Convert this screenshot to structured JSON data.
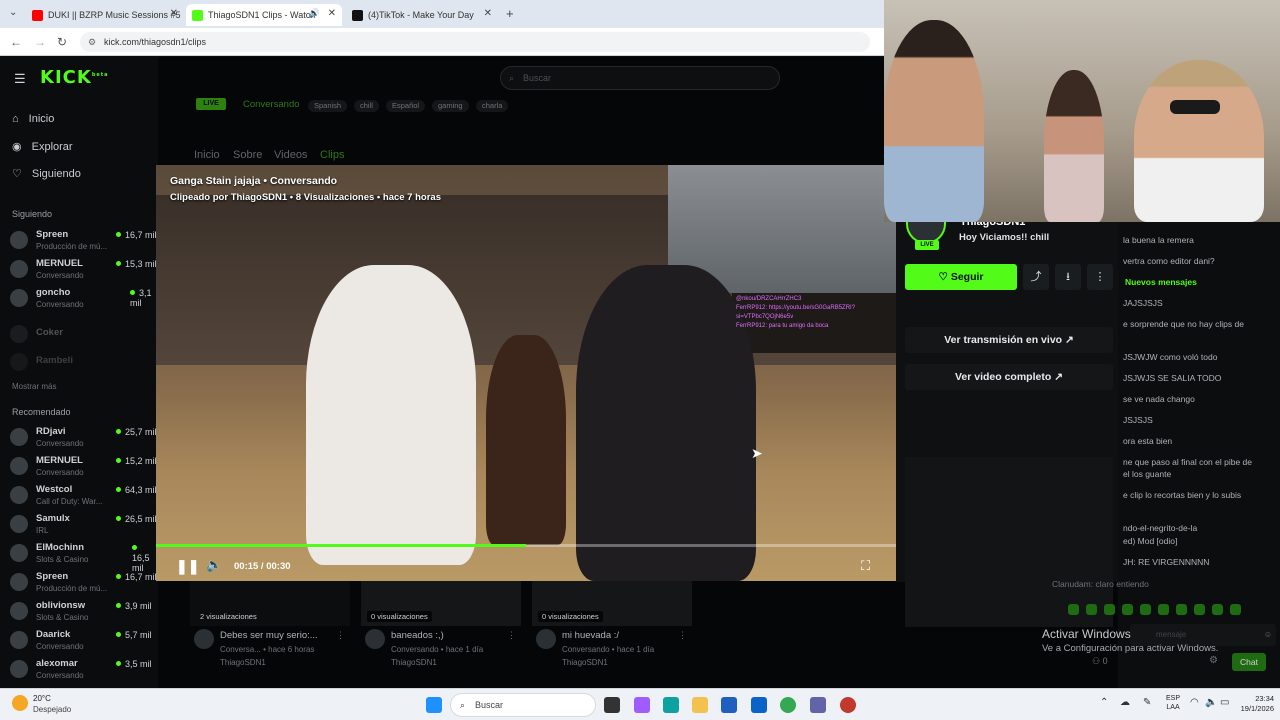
{
  "browser": {
    "tabs": [
      {
        "title": "DUKI || BZRP Music Sessions #5",
        "favicon_color": "#ff0000"
      },
      {
        "title": "ThiagoSDN1 Clips - Watch",
        "favicon_color": "#53fc18"
      },
      {
        "title": "(4)TikTok - Make Your Day",
        "favicon_color": "#111111"
      }
    ],
    "url": "kick.com/thiagosdn1/clips"
  },
  "kick": {
    "logo": "KICK",
    "beta": "beta",
    "search_placeholder": "Buscar",
    "nav": [
      {
        "label": "Inicio",
        "icon": "home-icon"
      },
      {
        "label": "Explorar",
        "icon": "compass-icon"
      },
      {
        "label": "Siguiendo",
        "icon": "heart-icon"
      }
    ],
    "following_heading": "Siguiendo",
    "following": [
      {
        "name": "Spreen",
        "game": "Producción de mú...",
        "viewers": "16,7 mil"
      },
      {
        "name": "MERNUEL",
        "game": "Conversando",
        "viewers": "15,3 mil"
      },
      {
        "name": "goncho",
        "game": "Conversando",
        "viewers": "3,1 mil"
      },
      {
        "name": "Coker",
        "game": "",
        "viewers": ""
      },
      {
        "name": "Rambeli",
        "game": "",
        "viewers": ""
      }
    ],
    "show_more": "Mostrar más",
    "recommended_heading": "Recomendado",
    "recommended": [
      {
        "name": "RDjavi",
        "game": "Conversando",
        "viewers": "25,7 mil"
      },
      {
        "name": "MERNUEL",
        "game": "Conversando",
        "viewers": "15,2 mil"
      },
      {
        "name": "Westcol",
        "game": "Call of Duty: War...",
        "viewers": "64,3 mil"
      },
      {
        "name": "Samulx",
        "game": "IRL",
        "viewers": "26,5 mil"
      },
      {
        "name": "ElMochinn",
        "game": "Slots & Casino",
        "viewers": "16,5 mil"
      },
      {
        "name": "Spreen",
        "game": "Producción de mú...",
        "viewers": "16,7 mil"
      },
      {
        "name": "oblivionsw",
        "game": "Slots & Casino",
        "viewers": "3,9 mil"
      },
      {
        "name": "Daarick",
        "game": "Conversando",
        "viewers": "5,7 mil"
      },
      {
        "name": "alexomar",
        "game": "Conversando",
        "viewers": "3,5 mil"
      }
    ],
    "live_badge": "LIVE",
    "category": "Conversando",
    "tags": [
      "Spanish",
      "chill",
      "Español",
      "gaming",
      "charla"
    ],
    "channel_tabs": [
      "Inicio",
      "Sobre",
      "Videos",
      "Clips"
    ],
    "active_tab": "Clips"
  },
  "clip": {
    "title": "Ganga Stain jajaja • Conversando",
    "subtitle": "Clipeado por ThiagoSDN1 • 8 Visualizaciones • hace 7 horas",
    "time": "00:15 / 00:30",
    "progress": 0.5,
    "overlay_chat": [
      "@nkou/DRZCAHrrZHC3",
      "FerrRP912: https://youtu.be/sG0GaRB5ZRI?si=VTPbc7QOjN6e5v",
      "FerrRP912: para tu amigo da boca"
    ]
  },
  "channel": {
    "name": "ThiagoSDN1",
    "stream_title": "Hoy Viciamos!! chill",
    "live": "LIVE",
    "follow_label": "Seguir",
    "watch_live_label": "Ver transmisión en vivo",
    "watch_full_label": "Ver video completo"
  },
  "chat": {
    "messages": [
      "la buena la remera",
      "vertra como editor dani?",
      "Nuevos mensajes",
      "JAJSJSJS",
      "e sorprende que no hay clips de",
      "JSJWJW como voló todo",
      "JSJWJS SE SALIA TODO",
      "se ve nada chango",
      "JSJSJS",
      "ora esta bien",
      "ne que paso al final con el pibe de",
      "el los guante",
      "e clip lo recortas bien y lo subis",
      "ndo-el-negrito-de-la",
      "ed) Mod [odio]",
      "JH: RE VIRGENNNNN",
      "Clanudam: claro entiendo"
    ],
    "input_placeholder": "mensaje",
    "viewer_count": "0",
    "chat_button": "Chat"
  },
  "clips_row": [
    {
      "views": "2 visualizaciones",
      "title": "Debes ser muy serio:...",
      "meta": "Conversa... • hace 6 horas",
      "author": "ThiagoSDN1"
    },
    {
      "views": "0 visualizaciones",
      "title": "baneados :,)",
      "meta": "Conversando • hace 1 día",
      "author": "ThiagoSDN1"
    },
    {
      "views": "0 visualizaciones",
      "title": "mi huevada :/",
      "meta": "Conversando • hace 1 día",
      "author": "ThiagoSDN1"
    }
  ],
  "windows_activation": {
    "line1": "Activar Windows",
    "line2": "Ve a Configuración para activar Windows."
  },
  "taskbar": {
    "weather_temp": "20°C",
    "weather_desc": "Despejado",
    "search_placeholder": "Buscar",
    "lang_top": "ESP",
    "lang_bottom": "LAA",
    "time": "23:34",
    "date": "19/1/2026"
  },
  "colors": {
    "kick_green": "#53fc18",
    "page_bg": "#050607"
  }
}
